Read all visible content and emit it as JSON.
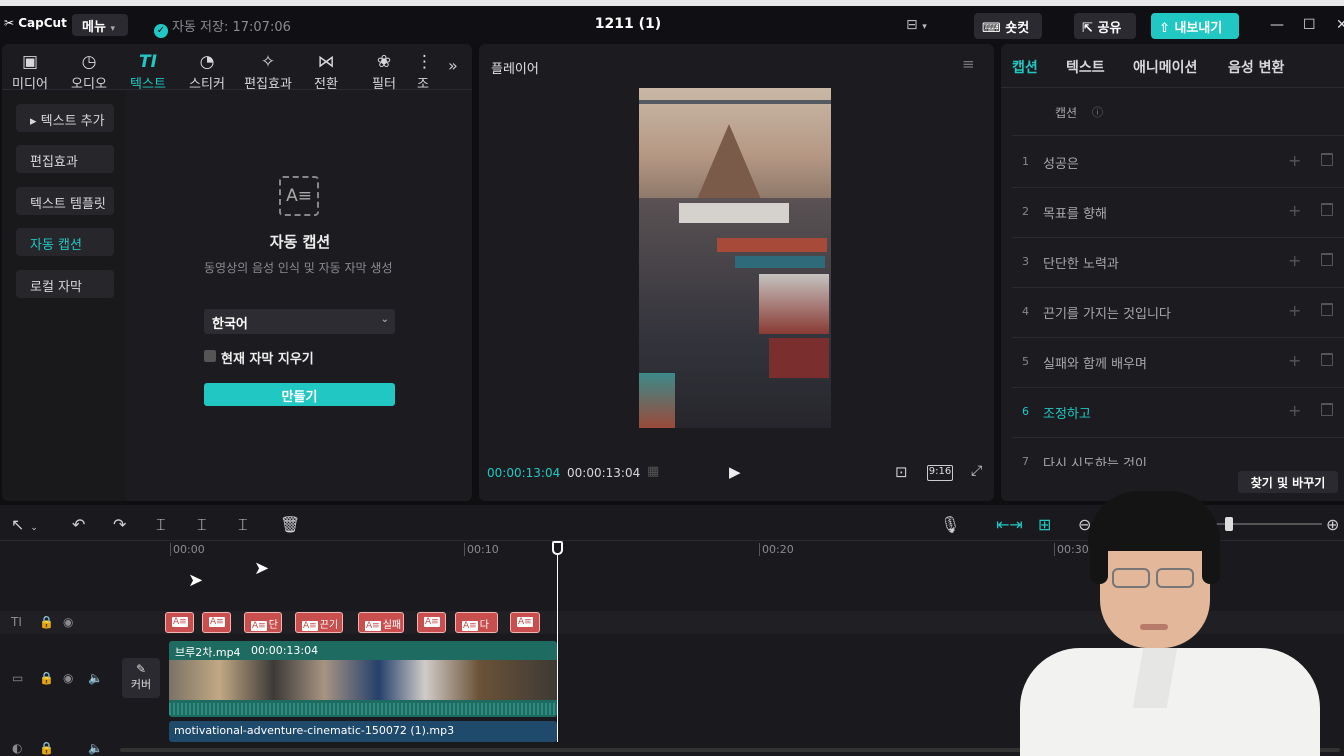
{
  "app": {
    "logo": "CapCut",
    "menu": "메뉴",
    "autosave": "자동 저장: 17:07:06",
    "project_title": "1211 (1)",
    "shortcut": "숏컷",
    "share": "공유",
    "export": "내보내기"
  },
  "left_tabs": [
    {
      "label": "미디어",
      "icon": "media-icon",
      "glyph": "▣"
    },
    {
      "label": "오디오",
      "icon": "audio-icon",
      "glyph": "◷"
    },
    {
      "label": "텍스트",
      "icon": "text-icon",
      "glyph": "TI"
    },
    {
      "label": "스티커",
      "icon": "sticker-icon",
      "glyph": "◔"
    },
    {
      "label": "편집효과",
      "icon": "effects-icon",
      "glyph": "✧"
    },
    {
      "label": "전환",
      "icon": "transition-icon",
      "glyph": "⋈"
    },
    {
      "label": "필터",
      "icon": "filter-icon",
      "glyph": "❀"
    },
    {
      "label": "조",
      "icon": "adjust-icon",
      "glyph": "⋮"
    }
  ],
  "active_tab": "텍스트",
  "side_menu": [
    "▸ 텍스트 추가",
    "편집효과",
    "텍스트 템플릿",
    "자동 캡션",
    "로컬 자막"
  ],
  "auto_caption": {
    "title": "자동 캡션",
    "desc": "동영상의 음성 인식 및 자동 자막 생성",
    "language": "한국어",
    "clear_label": "현재 자막 지우기",
    "create_btn": "만들기"
  },
  "player": {
    "title": "플레이어",
    "current": "00:00:13:04",
    "total": "00:00:13:04",
    "ratio": "9:16"
  },
  "right_tabs": [
    "캡션",
    "텍스트",
    "애니메이션",
    "음성 변환"
  ],
  "captions_header": "캡션",
  "captions": [
    {
      "n": "1",
      "text": "성공은"
    },
    {
      "n": "2",
      "text": "목표를 향해"
    },
    {
      "n": "3",
      "text": "단단한 노력과"
    },
    {
      "n": "4",
      "text": "끈기를 가지는 것입니다"
    },
    {
      "n": "5",
      "text": "실패와 함께 배우며"
    },
    {
      "n": "6",
      "text": "조정하고"
    },
    {
      "n": "7",
      "text": "다시 시도하는 것이"
    }
  ],
  "active_caption": "6",
  "find_replace": "찾기 및 바꾸기",
  "timeline": {
    "ruler": [
      "00:00",
      "00:10",
      "00:20",
      "00:30"
    ],
    "caption_clips": [
      "",
      "",
      "단",
      "끈기",
      "실패",
      "",
      "다",
      ""
    ],
    "video_name": "브루2차.mp4",
    "video_duration": "00:00:13:04",
    "cover": "커버",
    "audio_name": "motivational-adventure-cinematic-150072 (1).mp3"
  },
  "colors": {
    "accent": "#21c8c3",
    "caption_clip": "#c94e4e",
    "video_track": "#1e6b62",
    "audio_track": "#1f4a6b"
  }
}
